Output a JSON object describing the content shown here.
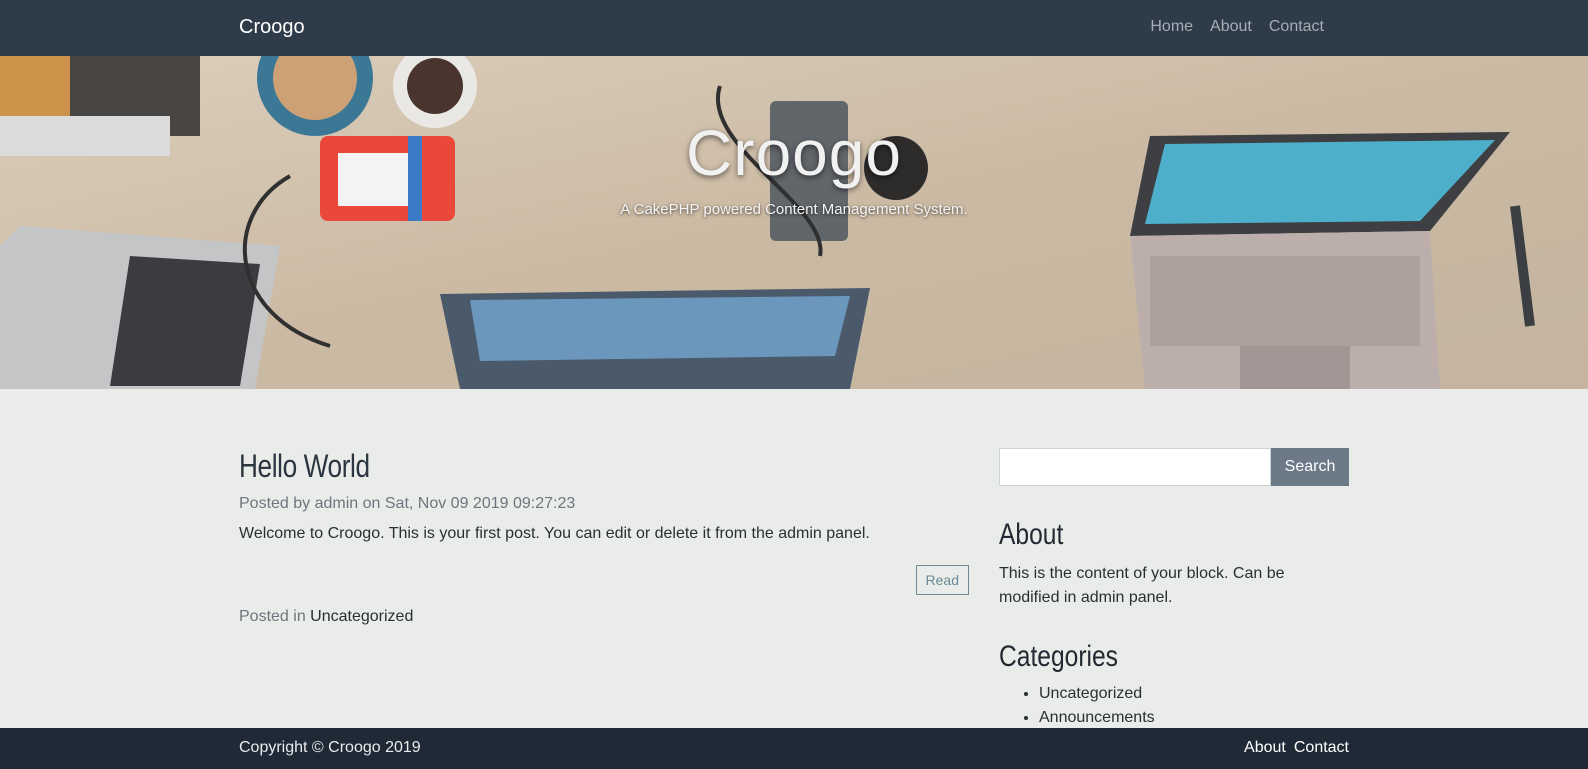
{
  "navbar": {
    "brand": "Croogo",
    "links": [
      "Home",
      "About",
      "Contact"
    ]
  },
  "hero": {
    "title": "Croogo",
    "subtitle": "A CakePHP powered Content Management System."
  },
  "post": {
    "title": "Hello World",
    "meta": "Posted by admin on Sat, Nov 09 2019 09:27:23",
    "body": "Welcome to Croogo. This is your first post. You can edit or delete it from the admin panel.",
    "read_label": "Read",
    "posted_in_label": "Posted in",
    "category": "Uncategorized"
  },
  "sidebar": {
    "search": {
      "placeholder": "",
      "value": "",
      "button_label": "Search"
    },
    "about": {
      "heading": "About",
      "text": "This is the content of your block. Can be modified in admin panel."
    },
    "categories": {
      "heading": "Categories",
      "items": [
        "Uncategorized",
        "Announcements"
      ]
    }
  },
  "footer": {
    "copyright": "Copyright © Croogo 2019",
    "links": [
      "About",
      "Contact"
    ]
  },
  "colors": {
    "navbar_bg": "#2e3b48",
    "footer_bg": "#1f2a36",
    "page_bg": "#eaecea",
    "search_button": "#6c7a88",
    "read_button_border": "#6a8a96"
  }
}
